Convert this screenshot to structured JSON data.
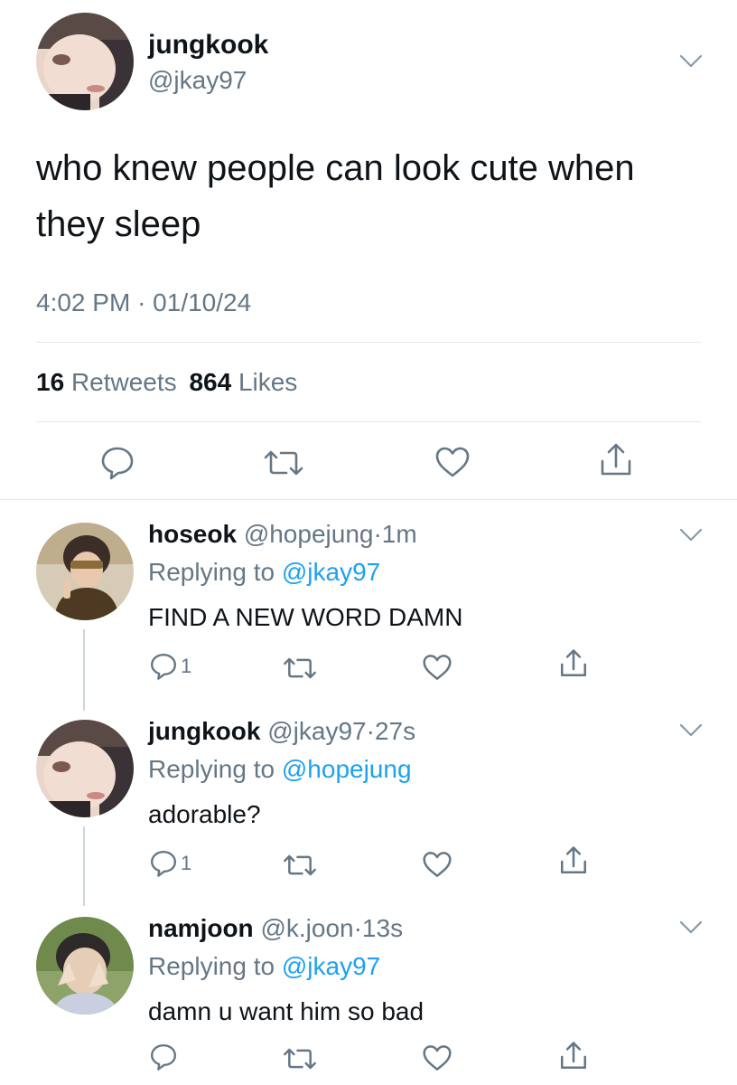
{
  "main_tweet": {
    "display_name": "jungkook",
    "handle": "@jkay97",
    "text_line1": "who knew people can look cute when",
    "text_line2": "they sleep",
    "time": "4:02 PM",
    "sep": "·",
    "date": "01/10/24",
    "retweets_count": "16",
    "retweets_label": "Retweets",
    "likes_count": "864",
    "likes_label": "Likes"
  },
  "replies": [
    {
      "display_name": "hoseok",
      "handle": "@hopejung",
      "sep": "·",
      "age": "1m",
      "replying_prefix": "Replying to",
      "replying_to": "@jkay97",
      "text": "FIND A NEW WORD DAMN",
      "reply_count": "1"
    },
    {
      "display_name": "jungkook",
      "handle": "@jkay97",
      "sep": "·",
      "age": "27s",
      "replying_prefix": "Replying to",
      "replying_to": "@hopejung",
      "text": "adorable?",
      "reply_count": "1"
    },
    {
      "display_name": "namjoon",
      "handle": "@k.joon",
      "sep": "·",
      "age": "13s",
      "replying_prefix": "Replying to",
      "replying_to": "@jkay97",
      "text": "damn u want him so bad",
      "reply_count": ""
    }
  ],
  "icons": {
    "reply": "comment-bubble-icon",
    "retweet": "retweet-arrows-icon",
    "like": "heart-icon",
    "share": "share-upload-icon",
    "more": "chevron-down-icon"
  },
  "colors": {
    "text": "#0f1419",
    "secondary": "#657786",
    "link": "#1da1f2",
    "divider": "#e1e8ed"
  }
}
